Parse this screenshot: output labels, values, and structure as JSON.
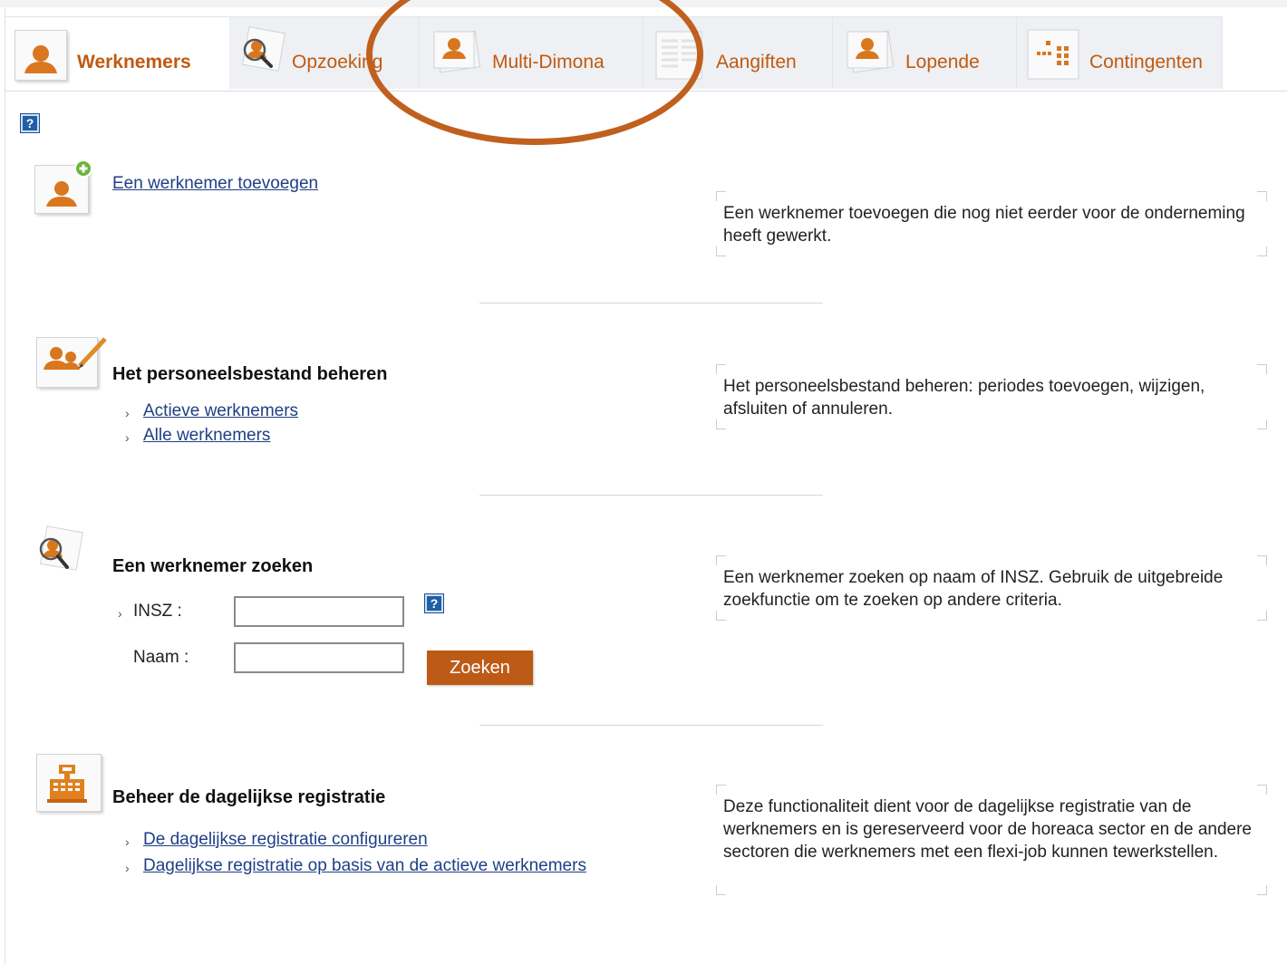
{
  "tabs": [
    {
      "label": "Werknemers",
      "icon": "person-icon",
      "active": true
    },
    {
      "label": "Opzoeking",
      "icon": "person-search-icon",
      "active": false
    },
    {
      "label": "Multi-Dimona",
      "icon": "person-stack-icon",
      "active": false
    },
    {
      "label": "Aangiften",
      "icon": "document-list-icon",
      "active": false
    },
    {
      "label": "Lopende",
      "icon": "person-stack-icon",
      "active": false
    },
    {
      "label": "Contingenten",
      "icon": "dots-grid-icon",
      "active": false
    }
  ],
  "help_symbol": "?",
  "sections": {
    "add": {
      "link": "Een werknemer toevoegen",
      "description": "Een werknemer toevoegen die nog niet eerder voor de onderneming heeft gewerkt."
    },
    "manage": {
      "title": "Het personeelsbestand beheren",
      "links": [
        "Actieve werknemers",
        "Alle werknemers"
      ],
      "description": "Het personeelsbestand beheren: periodes toevoegen, wijzigen, afsluiten of annuleren."
    },
    "search": {
      "title": "Een werknemer zoeken",
      "insz_label": "INSZ :",
      "name_label": "Naam :",
      "insz_value": "",
      "name_value": "",
      "button": "Zoeken",
      "description": "Een werknemer zoeken op naam of INSZ. Gebruik de uitgebreide zoekfunctie om te zoeken op andere criteria."
    },
    "daily": {
      "title": "Beheer de dagelijkse registratie",
      "links": [
        "De dagelijkse registratie configureren",
        "Dagelijkse registratie op basis van de actieve werknemers"
      ],
      "description": "Deze functionaliteit dient voor de dagelijkse registratie van de werknemers en is gereserveerd voor de horeaca sector en de andere sectoren die werknemers met een flexi-job kunnen tewerkstellen."
    }
  },
  "colors": {
    "accent": "#c05a12",
    "button": "#bc5a16",
    "link": "#1f3f86",
    "help": "#1f5fa6",
    "annotation": "#c0601f"
  }
}
